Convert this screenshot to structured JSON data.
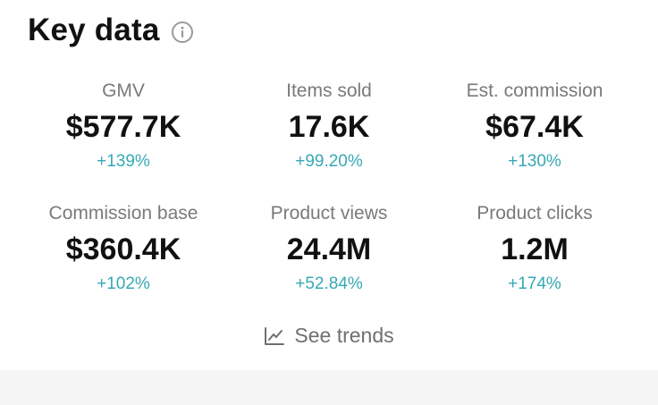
{
  "header": {
    "title": "Key data"
  },
  "metrics": [
    {
      "label": "GMV",
      "value": "$577.7K",
      "delta": "+139%"
    },
    {
      "label": "Items sold",
      "value": "17.6K",
      "delta": "+99.20%"
    },
    {
      "label": "Est. commission",
      "value": "$67.4K",
      "delta": "+130%"
    },
    {
      "label": "Commission base",
      "value": "$360.4K",
      "delta": "+102%"
    },
    {
      "label": "Product views",
      "value": "24.4M",
      "delta": "+52.84%"
    },
    {
      "label": "Product clicks",
      "value": "1.2M",
      "delta": "+174%"
    }
  ],
  "trends": {
    "label": "See trends",
    "icon": "line-chart-icon"
  },
  "colors": {
    "delta": "#36a9b5",
    "label": "#7a7a7a",
    "value": "#111111",
    "strip": "#f5f5f5"
  }
}
